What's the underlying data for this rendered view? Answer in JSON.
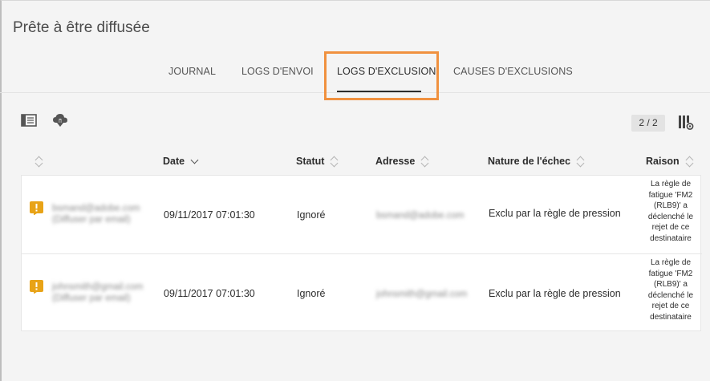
{
  "page": {
    "title": "Prête à être diffusée"
  },
  "tabs": [
    {
      "label": "JOURNAL"
    },
    {
      "label": "LOGS D'ENVOI"
    },
    {
      "label": "LOGS D'EXCLUSION",
      "active": true
    },
    {
      "label": "CAUSES D'EXCLUSIONS"
    }
  ],
  "toolbar": {
    "panel_icon": "sidebar-toggle-icon",
    "download_icon": "cloud-download-icon",
    "pager_text": "2 / 2",
    "settings_icon": "column-settings-icon"
  },
  "table": {
    "headers": {
      "date": "Date",
      "statut": "Statut",
      "adresse": "Adresse",
      "nature": "Nature de l'échec",
      "raison": "Raison"
    },
    "rows": [
      {
        "recipient_line1": "bsmand@adobe.com",
        "recipient_line2": "(Diffuser par email)",
        "date": "09/11/2017 07:01:30",
        "statut": "Ignoré",
        "adresse": "bsmand@adobe.com",
        "nature": "Exclu par la règle de pression",
        "raison": "La règle de fatigue 'FM2 (RLB9)' a déclenché le rejet de ce destinataire"
      },
      {
        "recipient_line1": "johnsmith@gmail.com",
        "recipient_line2": "(Diffuser par email)",
        "date": "09/11/2017 07:01:30",
        "statut": "Ignoré",
        "adresse": "johnsmith@gmail.com",
        "nature": "Exclu par la règle de pression",
        "raison": "La règle de fatigue 'FM2 (RLB9)' a déclenché le rejet de ce destinataire"
      }
    ]
  },
  "colors": {
    "highlight": "#f0913f",
    "warning": "#e8a317"
  }
}
